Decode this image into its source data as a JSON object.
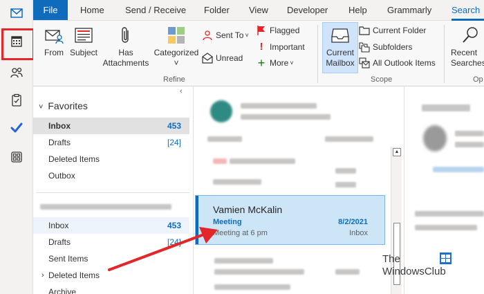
{
  "tabs": [
    "File",
    "Home",
    "Send / Receive",
    "Folder",
    "View",
    "Developer",
    "Help",
    "Grammarly",
    "Search"
  ],
  "ribbon": {
    "refine": {
      "from": "From",
      "subject": "Subject",
      "has_attachments_line1": "Has",
      "has_attachments_line2": "Attachments",
      "categorized": "Categorized",
      "sent_to": "Sent To",
      "unread": "Unread",
      "flagged": "Flagged",
      "important": "Important",
      "more": "More",
      "group_label": "Refine"
    },
    "scope": {
      "current_mailbox_line1": "Current",
      "current_mailbox_line2": "Mailbox",
      "current_folder": "Current Folder",
      "subfolders": "Subfolders",
      "all_outlook_items": "All Outlook Items",
      "group_label": "Scope"
    },
    "options": {
      "recent_searches_line1": "Recent",
      "recent_searches_line2": "Searches",
      "group_label": "Op"
    }
  },
  "folders": {
    "favorites_heading": "Favorites",
    "favorites": [
      {
        "label": "Inbox",
        "count": "453"
      },
      {
        "label": "Drafts",
        "count": "[24]"
      },
      {
        "label": "Deleted Items",
        "count": ""
      },
      {
        "label": "Outbox",
        "count": ""
      }
    ],
    "account": [
      {
        "label": "Inbox",
        "count": "453"
      },
      {
        "label": "Drafts",
        "count": "[24]"
      },
      {
        "label": "Sent Items",
        "count": ""
      },
      {
        "label": "Deleted Items",
        "count": ""
      },
      {
        "label": "Archive",
        "count": ""
      }
    ]
  },
  "selected_message": {
    "sender": "Vamien McKalin",
    "subject": "Meeting",
    "date": "8/2/2021",
    "preview": "Meeting at 6 pm",
    "folder": "Inbox"
  },
  "watermark": {
    "line1": "The",
    "line2": "WindowsClub"
  },
  "colors": {
    "accent": "#0f6cbd",
    "highlight_red": "#e3262a",
    "selection": "#cde6f7"
  }
}
